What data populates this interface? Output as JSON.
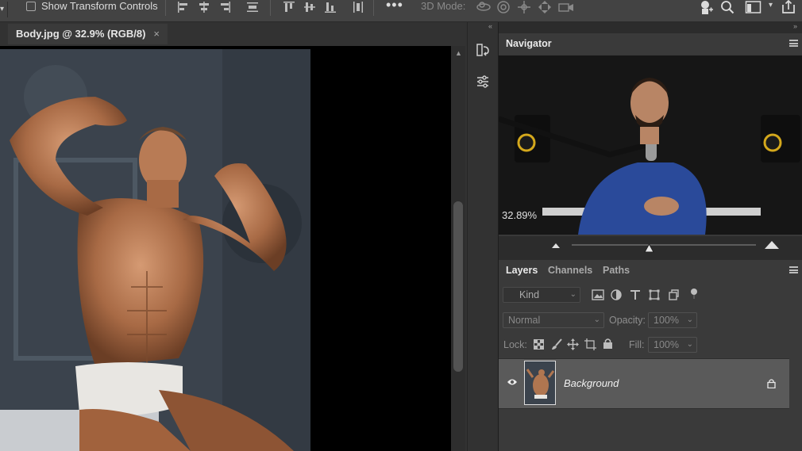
{
  "options_bar": {
    "show_transform_controls_label": "Show Transform Controls",
    "show_transform_controls_checked": false,
    "more_label": "•••",
    "mode_3d_label": "3D Mode:"
  },
  "document": {
    "tab_title": "Body.jpg @ 32.9% (RGB/8)",
    "tab_close": "×"
  },
  "navigator": {
    "title": "Navigator",
    "zoom": "32.89%",
    "zoom_slider_fraction": 0.42
  },
  "layers_panel": {
    "tabs": [
      "Layers",
      "Channels",
      "Paths"
    ],
    "active_tab": "Layers",
    "filter_placeholder": "Kind",
    "blend_mode": "Normal",
    "opacity_label": "Opacity:",
    "opacity_value": "100%",
    "lock_label": "Lock:",
    "fill_label": "Fill:",
    "fill_value": "100%",
    "layers": [
      {
        "name": "Background",
        "visible": true,
        "locked": true
      }
    ]
  },
  "colors": {
    "app_bg": "#323232",
    "panel_bg": "#3a3a3a",
    "selected_layer": "#5a5a5a"
  }
}
